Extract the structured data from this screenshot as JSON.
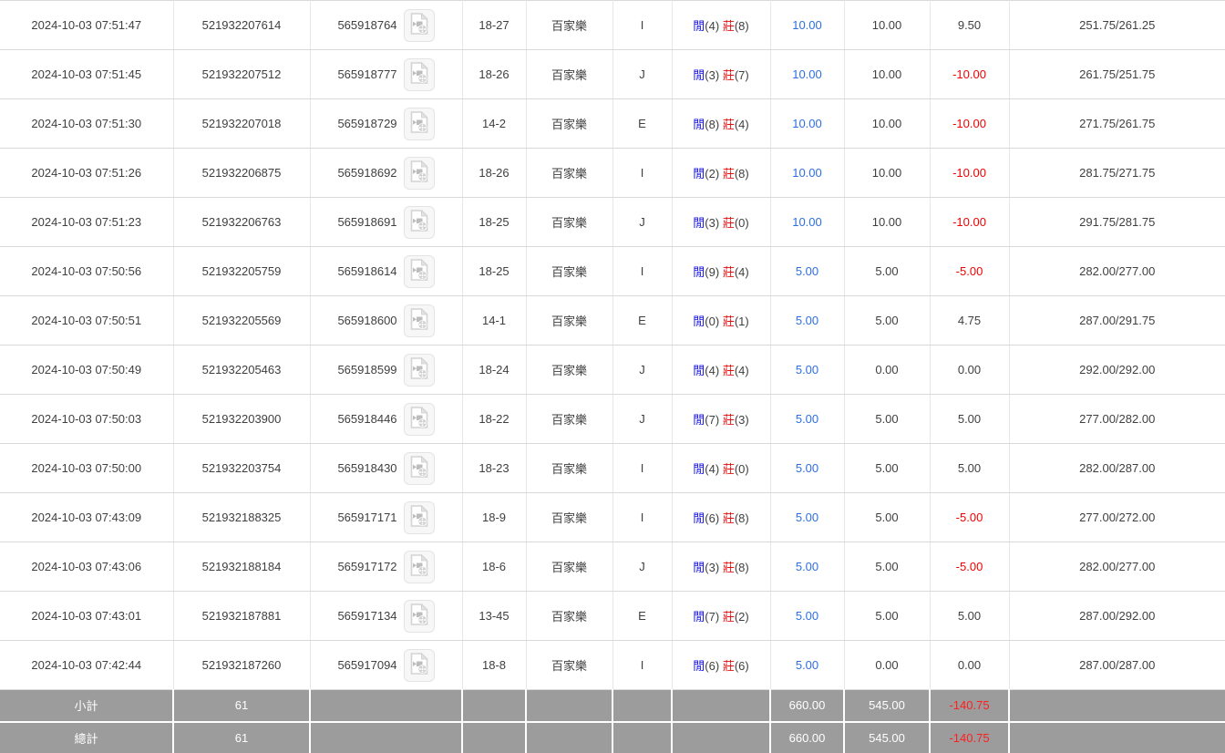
{
  "table": {
    "game_type_label": "百家樂",
    "result_labels": {
      "player": "閒",
      "banker": "莊"
    },
    "rows": [
      {
        "time": "2024-10-03 07:51:47",
        "bet_id": "521932207614",
        "game_id": "565918764",
        "table_round": "18-27",
        "game_type": "百家樂",
        "seat": "I",
        "player": "4",
        "banker": "8",
        "bet": "10.00",
        "valid": "10.00",
        "winloss": "9.50",
        "balance": "251.75/261.25"
      },
      {
        "time": "2024-10-03 07:51:45",
        "bet_id": "521932207512",
        "game_id": "565918777",
        "table_round": "18-26",
        "game_type": "百家樂",
        "seat": "J",
        "player": "3",
        "banker": "7",
        "bet": "10.00",
        "valid": "10.00",
        "winloss": "-10.00",
        "balance": "261.75/251.75"
      },
      {
        "time": "2024-10-03 07:51:30",
        "bet_id": "521932207018",
        "game_id": "565918729",
        "table_round": "14-2",
        "game_type": "百家樂",
        "seat": "E",
        "player": "8",
        "banker": "4",
        "bet": "10.00",
        "valid": "10.00",
        "winloss": "-10.00",
        "balance": "271.75/261.75"
      },
      {
        "time": "2024-10-03 07:51:26",
        "bet_id": "521932206875",
        "game_id": "565918692",
        "table_round": "18-26",
        "game_type": "百家樂",
        "seat": "I",
        "player": "2",
        "banker": "8",
        "bet": "10.00",
        "valid": "10.00",
        "winloss": "-10.00",
        "balance": "281.75/271.75"
      },
      {
        "time": "2024-10-03 07:51:23",
        "bet_id": "521932206763",
        "game_id": "565918691",
        "table_round": "18-25",
        "game_type": "百家樂",
        "seat": "J",
        "player": "3",
        "banker": "0",
        "bet": "10.00",
        "valid": "10.00",
        "winloss": "-10.00",
        "balance": "291.75/281.75"
      },
      {
        "time": "2024-10-03 07:50:56",
        "bet_id": "521932205759",
        "game_id": "565918614",
        "table_round": "18-25",
        "game_type": "百家樂",
        "seat": "I",
        "player": "9",
        "banker": "4",
        "bet": "5.00",
        "valid": "5.00",
        "winloss": "-5.00",
        "balance": "282.00/277.00"
      },
      {
        "time": "2024-10-03 07:50:51",
        "bet_id": "521932205569",
        "game_id": "565918600",
        "table_round": "14-1",
        "game_type": "百家樂",
        "seat": "E",
        "player": "0",
        "banker": "1",
        "bet": "5.00",
        "valid": "5.00",
        "winloss": "4.75",
        "balance": "287.00/291.75"
      },
      {
        "time": "2024-10-03 07:50:49",
        "bet_id": "521932205463",
        "game_id": "565918599",
        "table_round": "18-24",
        "game_type": "百家樂",
        "seat": "J",
        "player": "4",
        "banker": "4",
        "bet": "5.00",
        "valid": "0.00",
        "winloss": "0.00",
        "balance": "292.00/292.00"
      },
      {
        "time": "2024-10-03 07:50:03",
        "bet_id": "521932203900",
        "game_id": "565918446",
        "table_round": "18-22",
        "game_type": "百家樂",
        "seat": "J",
        "player": "7",
        "banker": "3",
        "bet": "5.00",
        "valid": "5.00",
        "winloss": "5.00",
        "balance": "277.00/282.00"
      },
      {
        "time": "2024-10-03 07:50:00",
        "bet_id": "521932203754",
        "game_id": "565918430",
        "table_round": "18-23",
        "game_type": "百家樂",
        "seat": "I",
        "player": "4",
        "banker": "0",
        "bet": "5.00",
        "valid": "5.00",
        "winloss": "5.00",
        "balance": "282.00/287.00"
      },
      {
        "time": "2024-10-03 07:43:09",
        "bet_id": "521932188325",
        "game_id": "565917171",
        "table_round": "18-9",
        "game_type": "百家樂",
        "seat": "I",
        "player": "6",
        "banker": "8",
        "bet": "5.00",
        "valid": "5.00",
        "winloss": "-5.00",
        "balance": "277.00/272.00"
      },
      {
        "time": "2024-10-03 07:43:06",
        "bet_id": "521932188184",
        "game_id": "565917172",
        "table_round": "18-6",
        "game_type": "百家樂",
        "seat": "J",
        "player": "3",
        "banker": "8",
        "bet": "5.00",
        "valid": "5.00",
        "winloss": "-5.00",
        "balance": "282.00/277.00"
      },
      {
        "time": "2024-10-03 07:43:01",
        "bet_id": "521932187881",
        "game_id": "565917134",
        "table_round": "13-45",
        "game_type": "百家樂",
        "seat": "E",
        "player": "7",
        "banker": "2",
        "bet": "5.00",
        "valid": "5.00",
        "winloss": "5.00",
        "balance": "287.00/292.00"
      },
      {
        "time": "2024-10-03 07:42:44",
        "bet_id": "521932187260",
        "game_id": "565917094",
        "table_round": "18-8",
        "game_type": "百家樂",
        "seat": "I",
        "player": "6",
        "banker": "6",
        "bet": "5.00",
        "valid": "0.00",
        "winloss": "0.00",
        "balance": "287.00/287.00"
      }
    ],
    "footer": [
      {
        "label": "小計",
        "count": "61",
        "bet": "660.00",
        "valid": "545.00",
        "winloss": "-140.75"
      },
      {
        "label": "總計",
        "count": "61",
        "bet": "660.00",
        "valid": "545.00",
        "winloss": "-140.75"
      }
    ],
    "colors": {
      "bet_amount_blue": "#2d6fe2",
      "player_blue": "#1512e6",
      "banker_red": "#e01212",
      "negative_red": "#f10000",
      "footer_gray": "#9c9c9c"
    }
  }
}
